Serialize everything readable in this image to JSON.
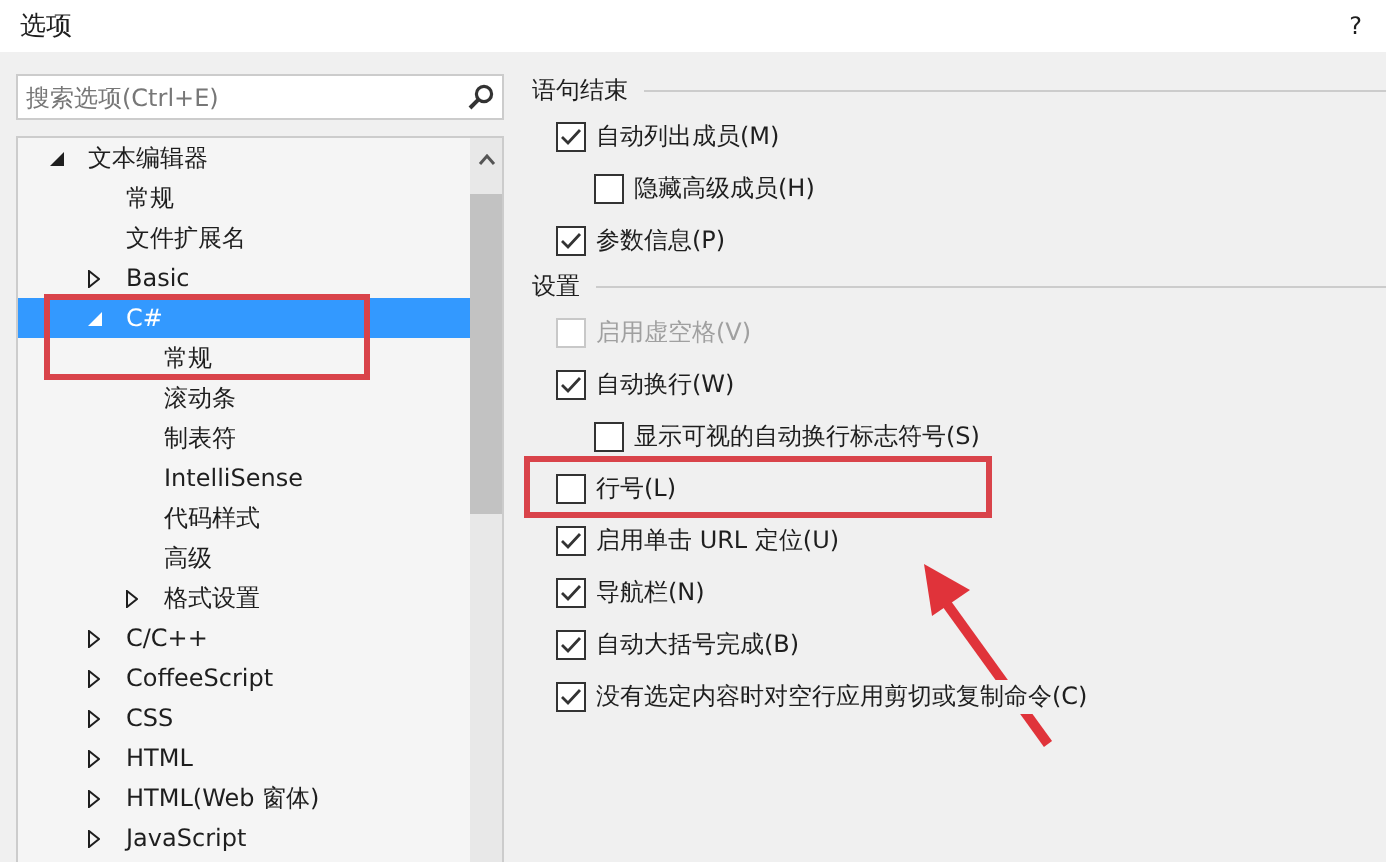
{
  "window": {
    "title": "选项",
    "help": "?"
  },
  "search": {
    "placeholder": "搜索选项(Ctrl+E)"
  },
  "tree": [
    {
      "label": "文本编辑器",
      "expanded": true,
      "selected": false,
      "children": [
        {
          "label": "常规",
          "selected": false
        },
        {
          "label": "文件扩展名",
          "selected": false
        },
        {
          "label": "Basic",
          "expanded": false,
          "selected": false
        },
        {
          "label": "C#",
          "expanded": true,
          "selected": true,
          "children": [
            {
              "label": "常规",
              "selected": false
            },
            {
              "label": "滚动条",
              "selected": false
            },
            {
              "label": "制表符",
              "selected": false
            },
            {
              "label": "IntelliSense",
              "selected": false
            },
            {
              "label": "代码样式",
              "selected": false
            },
            {
              "label": "高级",
              "selected": false
            },
            {
              "label": "格式设置",
              "expanded": false,
              "selected": false
            }
          ]
        },
        {
          "label": "C/C++",
          "expanded": false,
          "selected": false
        },
        {
          "label": "CoffeeScript",
          "expanded": false,
          "selected": false
        },
        {
          "label": "CSS",
          "expanded": false,
          "selected": false
        },
        {
          "label": "HTML",
          "expanded": false,
          "selected": false
        },
        {
          "label": "HTML(Web 窗体)",
          "expanded": false,
          "selected": false
        },
        {
          "label": "JavaScript",
          "expanded": false,
          "selected": false
        }
      ]
    }
  ],
  "sections": [
    {
      "title": "语句结束",
      "options": [
        {
          "label": "自动列出成员(M)",
          "checked": true,
          "disabled": false,
          "children": [
            {
              "label": "隐藏高级成员(H)",
              "checked": false,
              "disabled": false
            }
          ]
        },
        {
          "label": "参数信息(P)",
          "checked": true,
          "disabled": false
        }
      ]
    },
    {
      "title": "设置",
      "options": [
        {
          "label": "启用虚空格(V)",
          "checked": false,
          "disabled": true
        },
        {
          "label": "自动换行(W)",
          "checked": true,
          "disabled": false,
          "children": [
            {
              "label": "显示可视的自动换行标志符号(S)",
              "checked": false,
              "disabled": false
            }
          ]
        },
        {
          "label": "行号(L)",
          "checked": false,
          "disabled": false
        },
        {
          "label": "启用单击 URL 定位(U)",
          "checked": true,
          "disabled": false
        },
        {
          "label": "导航栏(N)",
          "checked": true,
          "disabled": false
        },
        {
          "label": "自动大括号完成(B)",
          "checked": true,
          "disabled": false
        },
        {
          "label": "没有选定内容时对空行应用剪切或复制命令(C)",
          "checked": true,
          "disabled": false
        }
      ]
    }
  ]
}
